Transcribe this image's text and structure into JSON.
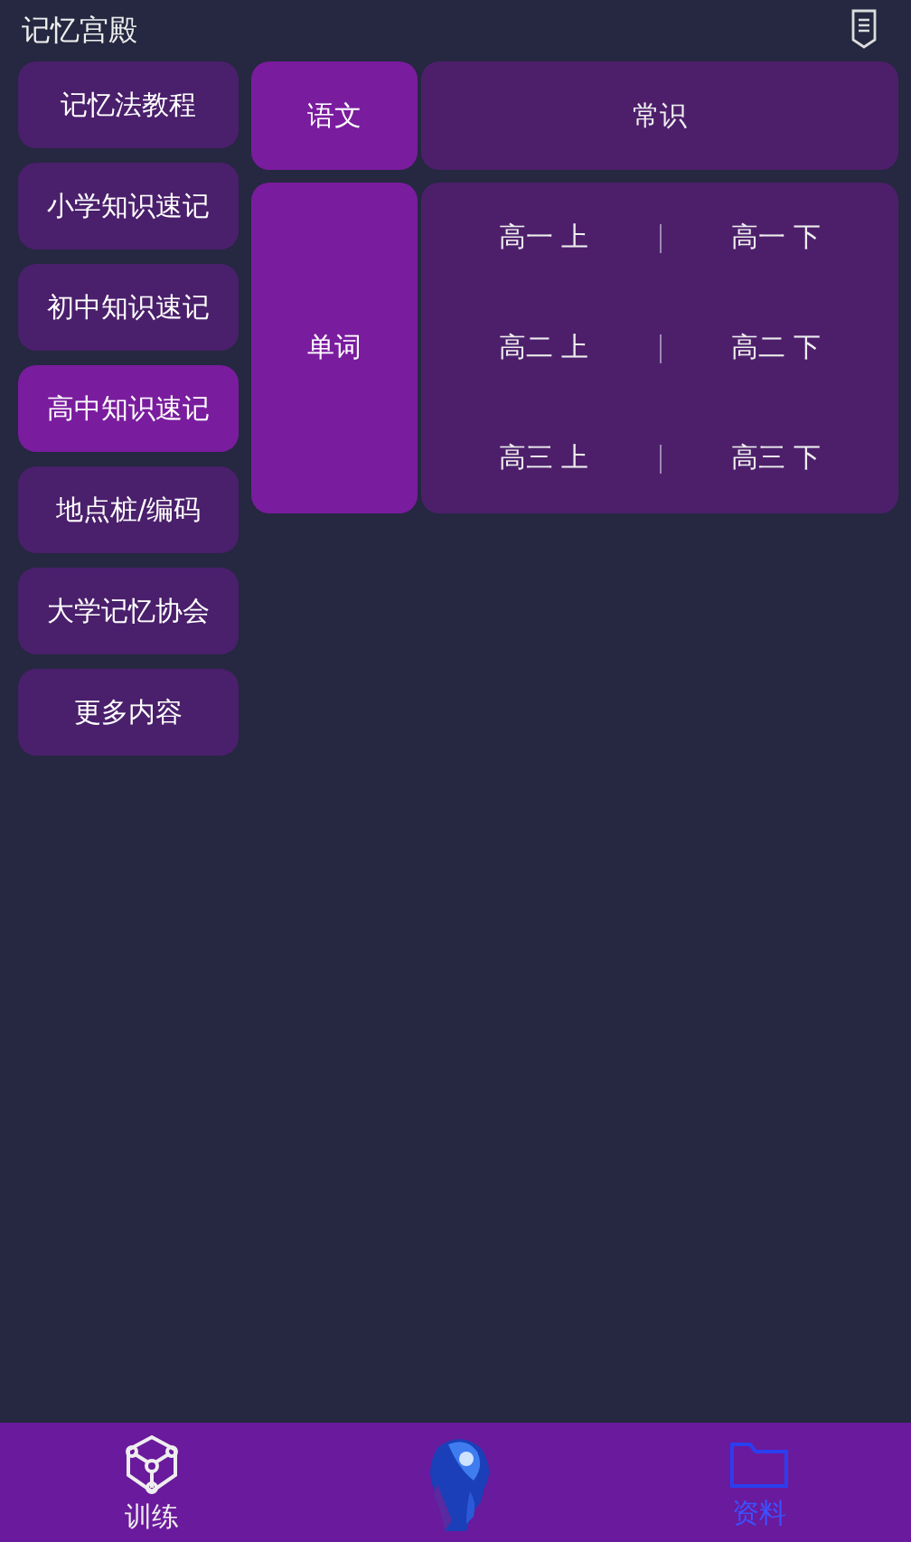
{
  "header": {
    "title": "记忆宫殿"
  },
  "sidebar": {
    "items": [
      {
        "label": "记忆法教程",
        "selected": false
      },
      {
        "label": "小学知识速记",
        "selected": false
      },
      {
        "label": "初中知识速记",
        "selected": false
      },
      {
        "label": "高中知识速记",
        "selected": true
      },
      {
        "label": "地点桩/编码",
        "selected": false
      },
      {
        "label": "大学记忆协会",
        "selected": false
      },
      {
        "label": "更多内容",
        "selected": false
      }
    ]
  },
  "categories": [
    {
      "label": "语文",
      "kind": "single",
      "items": [
        "常识"
      ]
    },
    {
      "label": "单词",
      "kind": "grid",
      "items": [
        "高一 上",
        "高一 下",
        "高二 上",
        "高二 下",
        "高三 上",
        "高三 下"
      ]
    }
  ],
  "bottom_nav": [
    {
      "kind": "train",
      "label": "训练",
      "selected": false
    },
    {
      "kind": "avatar"
    },
    {
      "kind": "folder",
      "label": "资料",
      "selected": true
    }
  ]
}
